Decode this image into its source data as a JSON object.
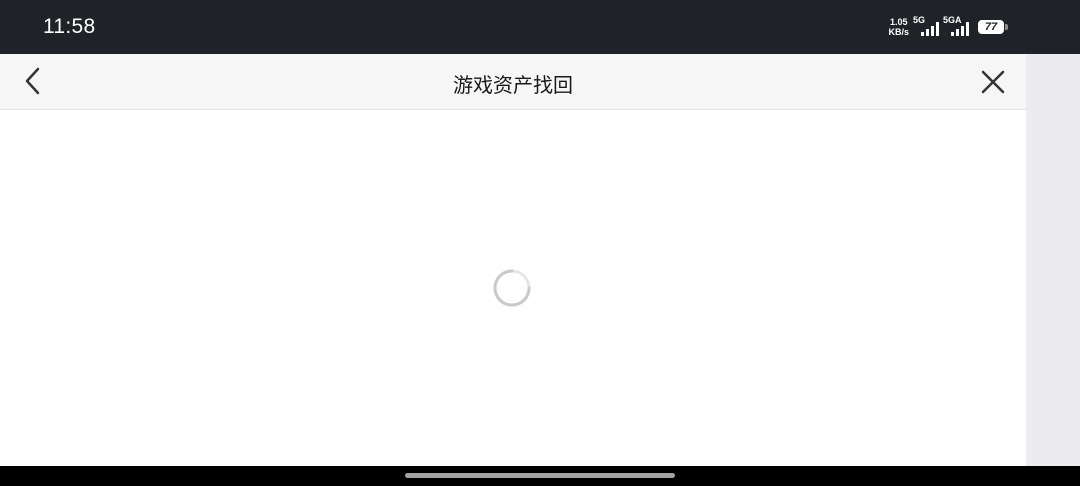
{
  "status_bar": {
    "time": "11:58",
    "net_speed_value": "1.05",
    "net_speed_unit": "KB/s",
    "signal_1_label": "5G",
    "signal_2_label": "5GA",
    "battery": "77"
  },
  "header": {
    "title": "游戏资产找回"
  },
  "content": {
    "state": "loading"
  }
}
